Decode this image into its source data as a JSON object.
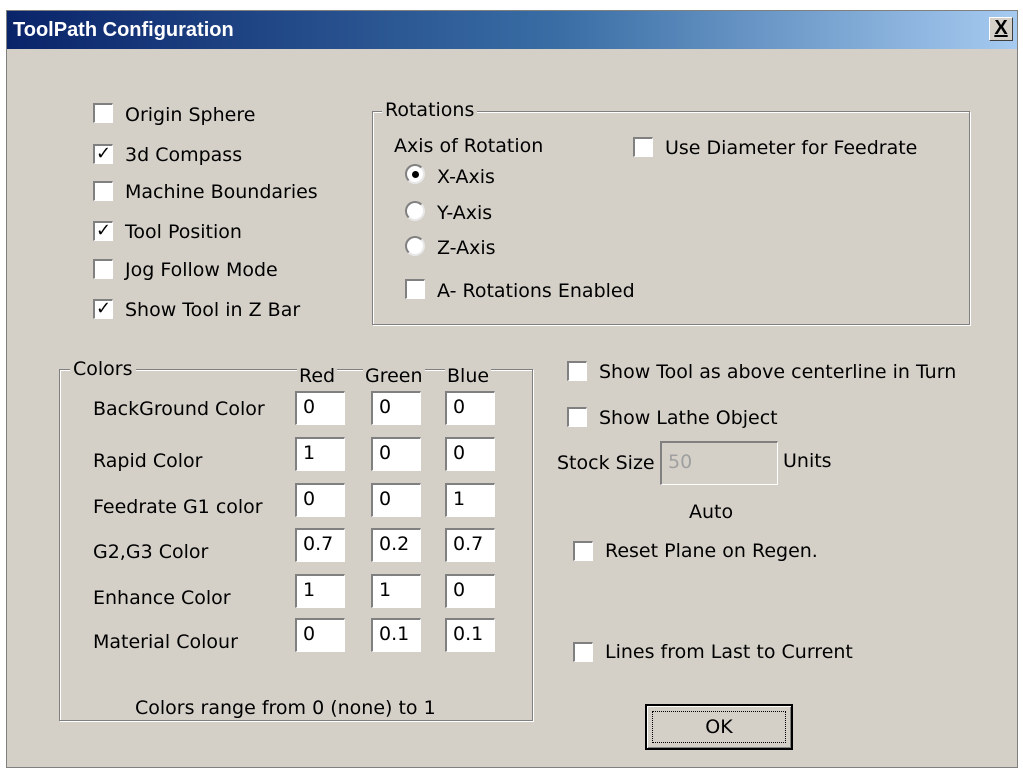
{
  "window": {
    "title": "ToolPath Configuration",
    "close_label": "X"
  },
  "display_options": [
    {
      "label": "Origin Sphere",
      "checked": false
    },
    {
      "label": "3d Compass",
      "checked": true
    },
    {
      "label": "Machine Boundaries",
      "checked": false
    },
    {
      "label": "Tool Position",
      "checked": true
    },
    {
      "label": "Jog Follow Mode",
      "checked": false
    },
    {
      "label": "Show Tool in Z Bar",
      "checked": true
    }
  ],
  "rotations": {
    "legend": "Rotations",
    "axis_label": "Axis of Rotation",
    "axes": [
      {
        "label": "X-Axis",
        "selected": true
      },
      {
        "label": "Y-Axis",
        "selected": false
      },
      {
        "label": "Z-Axis",
        "selected": false
      }
    ],
    "use_diameter": {
      "label": "Use Diameter for Feedrate",
      "checked": false
    },
    "a_rotations": {
      "label": "A- Rotations Enabled",
      "checked": false
    }
  },
  "colors": {
    "legend": "Colors",
    "headers": [
      "Red",
      "Green",
      "Blue"
    ],
    "rows": [
      {
        "label": "BackGround Color",
        "values": [
          "0",
          "0",
          "0"
        ]
      },
      {
        "label": "Rapid Color",
        "values": [
          "1",
          "0",
          "0"
        ]
      },
      {
        "label": "Feedrate G1 color",
        "values": [
          "0",
          "0",
          "1"
        ]
      },
      {
        "label": "G2,G3 Color",
        "values": [
          "0.7",
          "0.2",
          "0.7"
        ]
      },
      {
        "label": "Enhance Color",
        "values": [
          "1",
          "1",
          "0"
        ]
      },
      {
        "label": "Material Colour",
        "values": [
          "0",
          "0.1",
          "0.1"
        ]
      }
    ],
    "note": "Colors range from 0 (none) to 1"
  },
  "lathe": {
    "show_tool_above": {
      "label": "Show Tool as above centerline in Turn",
      "checked": false
    },
    "show_lathe_object": {
      "label": "Show Lathe Object",
      "checked": false
    },
    "stock_size_label": "Stock Size",
    "stock_size_value": "50",
    "units_label": "Units",
    "auto_label": "Auto",
    "reset_plane": {
      "label": "Reset Plane on Regen.",
      "checked": false
    },
    "lines_last_current": {
      "label": "Lines from Last to Current",
      "checked": false
    }
  },
  "buttons": {
    "ok_label": "OK"
  },
  "check_glyph": "✓"
}
